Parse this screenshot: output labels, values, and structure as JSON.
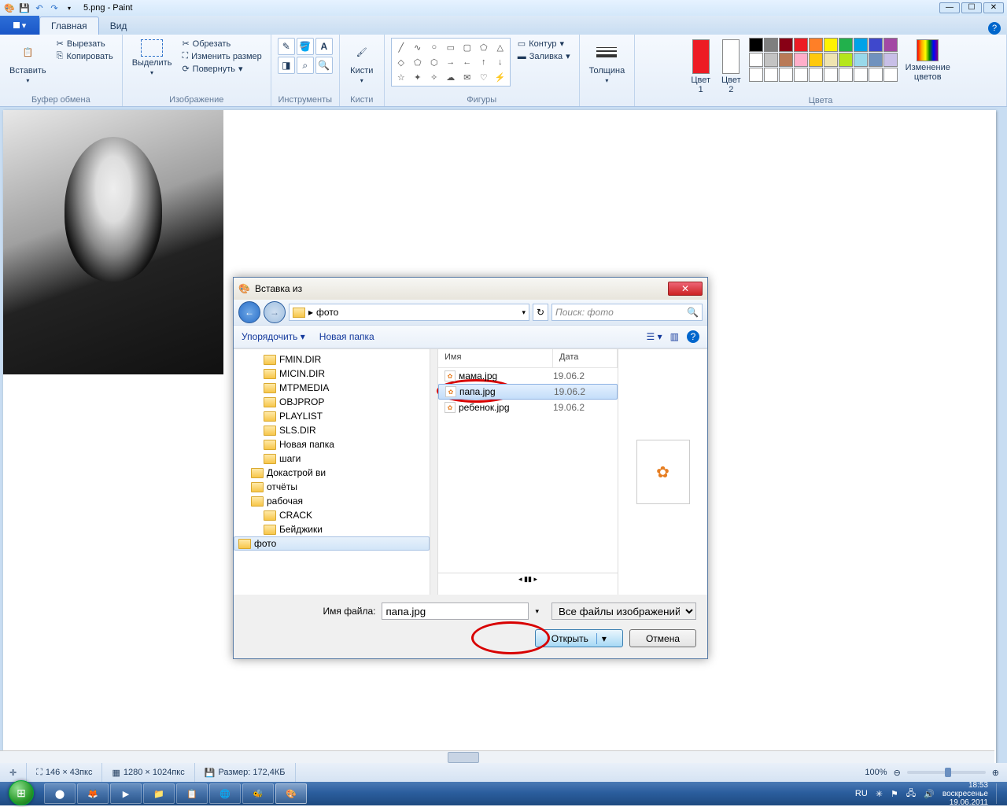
{
  "app": {
    "title": "5.png - Paint"
  },
  "tabs": {
    "home": "Главная",
    "view": "Вид"
  },
  "ribbon": {
    "clipboard": {
      "label": "Буфер обмена",
      "paste": "Вставить",
      "cut": "Вырезать",
      "copy": "Копировать"
    },
    "image": {
      "label": "Изображение",
      "select": "Выделить",
      "crop": "Обрезать",
      "resize": "Изменить размер",
      "rotate": "Повернуть"
    },
    "tools": {
      "label": "Инструменты"
    },
    "brushes": {
      "label": "Кисти",
      "btn": "Кисти"
    },
    "shapes": {
      "label": "Фигуры",
      "outline": "Контур",
      "fill": "Заливка"
    },
    "size": {
      "label": "Толщина"
    },
    "colors": {
      "label": "Цвета",
      "color1": "Цвет\n1",
      "color2": "Цвет\n2",
      "edit": "Изменение\nцветов",
      "palette": [
        "#000",
        "#7f7f7f",
        "#880015",
        "#ed1c24",
        "#ff7f27",
        "#fff200",
        "#22b14c",
        "#00a2e8",
        "#3f48cc",
        "#a349a4",
        "#fff",
        "#c3c3c3",
        "#b97a57",
        "#ffaec9",
        "#ffc90e",
        "#efe4b0",
        "#b5e61d",
        "#99d9ea",
        "#7092be",
        "#c8bfe7"
      ]
    },
    "color1_value": "#ed1c24",
    "color2_value": "#ffffff"
  },
  "dialog": {
    "title": "Вставка из",
    "breadcrumb": "фото",
    "search_placeholder": "Поиск: фото",
    "organize": "Упорядочить",
    "new_folder": "Новая папка",
    "tree": [
      {
        "name": "FMIN.DIR",
        "lvl": 2
      },
      {
        "name": "MICIN.DIR",
        "lvl": 2
      },
      {
        "name": "MTPMEDIA",
        "lvl": 2
      },
      {
        "name": "OBJPROP",
        "lvl": 2
      },
      {
        "name": "PLAYLIST",
        "lvl": 2
      },
      {
        "name": "SLS.DIR",
        "lvl": 2
      },
      {
        "name": "Новая папка",
        "lvl": 2
      },
      {
        "name": "шаги",
        "lvl": 2
      },
      {
        "name": "Докастрой ви",
        "lvl": 1
      },
      {
        "name": "отчёты",
        "lvl": 1
      },
      {
        "name": "рабочая",
        "lvl": 1
      },
      {
        "name": "CRACK",
        "lvl": 2
      },
      {
        "name": "Бейджики",
        "lvl": 2
      },
      {
        "name": "фото",
        "lvl": 1,
        "sel": true
      }
    ],
    "cols": {
      "name": "Имя",
      "date": "Дата"
    },
    "files": [
      {
        "name": "мама.jpg",
        "date": "19.06.2"
      },
      {
        "name": "папа.jpg",
        "date": "19.06.2",
        "sel": true
      },
      {
        "name": "ребенок.jpg",
        "date": "19.06.2"
      }
    ],
    "filename_label": "Имя файла:",
    "filename_value": "папа.jpg",
    "filter": "Все файлы изображений",
    "open": "Открыть",
    "cancel": "Отмена"
  },
  "status": {
    "pointer": "146 × 43пкс",
    "canvas": "1280 × 1024пкс",
    "size": "Размер: 172,4КБ",
    "zoom": "100%"
  },
  "taskbar": {
    "lang": "RU",
    "time": "18:53",
    "day": "воскресенье",
    "date": "19.06.2011"
  }
}
